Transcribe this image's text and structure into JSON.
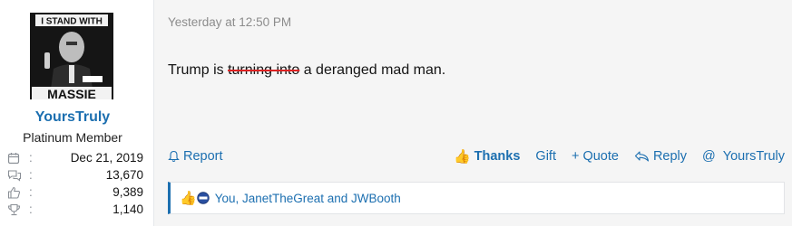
{
  "user": {
    "avatar": {
      "alt_text": "I STAND WITH MASSIE"
    },
    "username": "YoursTruly",
    "title": "Platinum Member",
    "stats": [
      {
        "icon": "calendar-icon",
        "value": "Dec 21, 2019"
      },
      {
        "icon": "messages-icon",
        "value": "13,670"
      },
      {
        "icon": "thumbs-up-icon",
        "value": "9,389"
      },
      {
        "icon": "trophy-icon",
        "value": "1,140"
      }
    ]
  },
  "post": {
    "date": "Yesterday at 12:50 PM",
    "body_start": "Trump is ",
    "body_struck": "turning into",
    "body_end": " a deranged mad man."
  },
  "actions": {
    "report": "Report",
    "thanks": "Thanks",
    "gift": "Gift",
    "quote": "Quote",
    "reply": "Reply",
    "mention": "YoursTruly"
  },
  "reactions": {
    "users": "You, JanetTheGreat and JWBooth"
  },
  "colors": {
    "link": "#1c6fb0",
    "thumb": "#f0a830",
    "strike": "#dd2222"
  }
}
